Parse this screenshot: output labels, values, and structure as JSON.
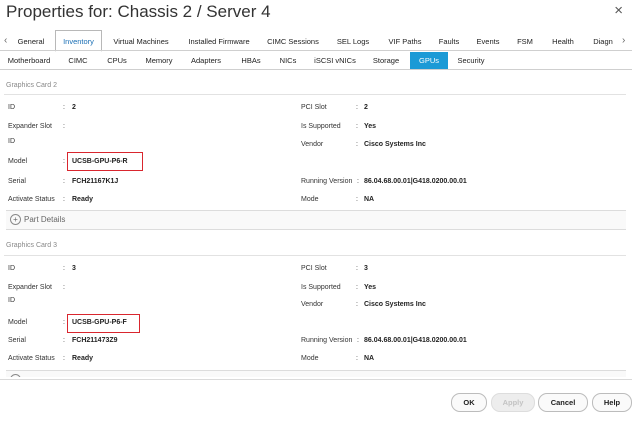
{
  "window": {
    "title": "Properties for: Chassis 2 / Server 4",
    "close": "×"
  },
  "tabs_primary": {
    "prev": "‹",
    "next": "›",
    "items": [
      {
        "label": "General"
      },
      {
        "label": "Inventory",
        "active": true
      },
      {
        "label": "Virtual Machines"
      },
      {
        "label": "Installed Firmware"
      },
      {
        "label": "CIMC Sessions"
      },
      {
        "label": "SEL Logs"
      },
      {
        "label": "VIF Paths"
      },
      {
        "label": "Faults"
      },
      {
        "label": "Events"
      },
      {
        "label": "FSM"
      },
      {
        "label": "Health"
      },
      {
        "label": "Diagn"
      }
    ]
  },
  "tabs_secondary": {
    "items": [
      {
        "label": "Motherboard"
      },
      {
        "label": "CIMC"
      },
      {
        "label": "CPUs"
      },
      {
        "label": "Memory"
      },
      {
        "label": "Adapters"
      },
      {
        "label": "HBAs"
      },
      {
        "label": "NICs"
      },
      {
        "label": "iSCSI vNICs"
      },
      {
        "label": "Storage"
      },
      {
        "label": "GPUs",
        "active": true
      },
      {
        "label": "Security"
      }
    ]
  },
  "cards": [
    {
      "title": "Graphics Card 2",
      "left": {
        "id_label": "ID",
        "id": "2",
        "expander_label": "Expander Slot",
        "expander_id_label": "ID",
        "model_label": "Model",
        "model": "UCSB-GPU-P6-R",
        "serial_label": "Serial",
        "serial": "FCH21167K1J",
        "status_label": "Activate Status",
        "status": "Ready"
      },
      "right": {
        "pci_label": "PCI Slot",
        "pci": "2",
        "supported_label": "Is Supported",
        "supported": "Yes",
        "vendor_label": "Vendor",
        "vendor": "Cisco Systems Inc",
        "running_label": "Running Version",
        "running": "86.04.68.00.01|G418.0200.00.01",
        "mode_label": "Mode",
        "mode": "NA"
      },
      "part_details": "Part Details"
    },
    {
      "title": "Graphics Card 3",
      "left": {
        "id_label": "ID",
        "id": "3",
        "expander_label": "Expander Slot",
        "expander_id_label": "ID",
        "model_label": "Model",
        "model": "UCSB-GPU-P6-F",
        "serial_label": "Serial",
        "serial": "FCH211473Z9",
        "status_label": "Activate Status",
        "status": "Ready"
      },
      "right": {
        "pci_label": "PCI Slot",
        "pci": "3",
        "supported_label": "Is Supported",
        "supported": "Yes",
        "vendor_label": "Vendor",
        "vendor": "Cisco Systems Inc",
        "running_label": "Running Version",
        "running": "86.04.68.00.01|G418.0200.00.01",
        "mode_label": "Mode",
        "mode": "NA"
      }
    }
  ],
  "footer": {
    "ok": "OK",
    "apply": "Apply",
    "cancel": "Cancel",
    "help": "Help"
  },
  "colors": {
    "accent": "#1b9ad6",
    "highlight_box": "#d9262e"
  }
}
